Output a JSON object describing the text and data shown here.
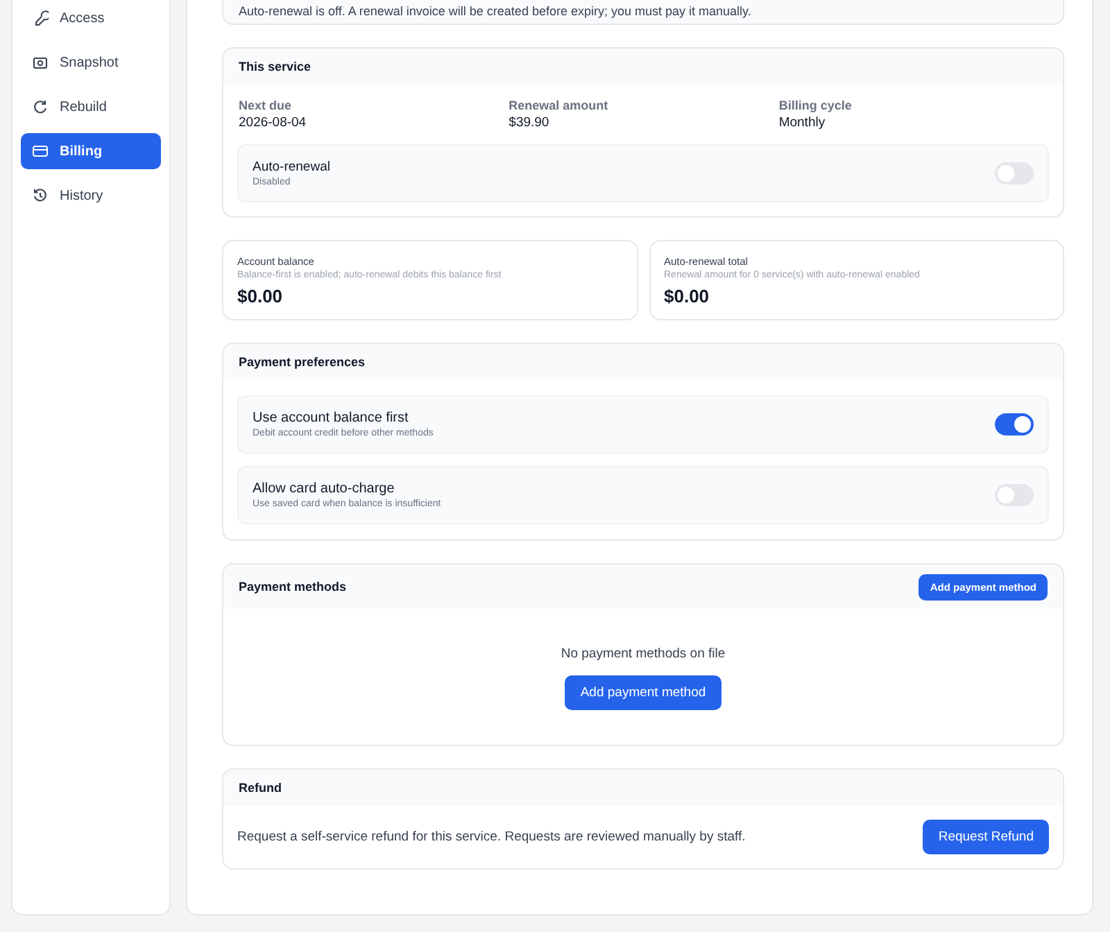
{
  "sidebar": {
    "items": [
      {
        "label": "Access",
        "selected": false
      },
      {
        "label": "Snapshot",
        "selected": false
      },
      {
        "label": "Rebuild",
        "selected": false
      },
      {
        "label": "Billing",
        "selected": true
      },
      {
        "label": "History",
        "selected": false
      }
    ]
  },
  "notice": {
    "text": "Auto-renewal is off. A renewal invoice will be created before expiry; you must pay it manually."
  },
  "this_service": {
    "title": "This service",
    "fields": [
      {
        "label": "Next due",
        "value": "2026-08-04"
      },
      {
        "label": "Renewal amount",
        "value": "$39.90"
      },
      {
        "label": "Billing cycle",
        "value": "Monthly"
      }
    ],
    "toggle": {
      "label": "Auto-renewal",
      "description": "Disabled",
      "on": false
    }
  },
  "stats": [
    {
      "label": "Account balance",
      "description": "Balance-first is enabled; auto-renewal debits this balance first",
      "value": "$0.00"
    },
    {
      "label": "Auto-renewal total",
      "description": "Renewal amount for 0 service(s) with auto-renewal enabled",
      "value": "$0.00"
    }
  ],
  "payment_preferences": {
    "title": "Payment preferences",
    "toggles": [
      {
        "label": "Use account balance first",
        "description": "Debit account credit before other methods",
        "on": true
      },
      {
        "label": "Allow card auto-charge",
        "description": "Use saved card when balance is insufficient",
        "on": false
      }
    ]
  },
  "payment_methods": {
    "title": "Payment methods",
    "header_button": "Add payment method",
    "empty_text": "No payment methods on file",
    "empty_button": "Add payment method"
  },
  "refund": {
    "title": "Refund",
    "text": "Request a self-service refund for this service. Requests are reviewed manually by staff.",
    "button": "Request Refund"
  }
}
